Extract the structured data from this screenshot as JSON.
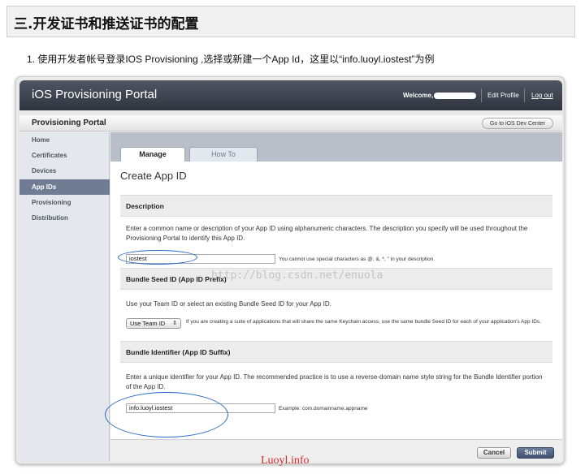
{
  "doc": {
    "heading": "三.开发证书和推送证书的配置",
    "step": "1. 使用开发者帐号登录IOS Provisioning ,选择或新建一个App Id，这里以“info.luoyl.iostest”为例"
  },
  "portal": {
    "title": "iOS Provisioning Portal",
    "welcome": "Welcome,",
    "edit_profile": "Edit Profile",
    "logout": "Log out",
    "subbar_title": "Provisioning Portal",
    "dev_center_button": "Go to iOS Dev Center"
  },
  "sidebar": {
    "items": [
      {
        "label": "Home"
      },
      {
        "label": "Certificates"
      },
      {
        "label": "Devices"
      },
      {
        "label": "App IDs"
      },
      {
        "label": "Provisioning"
      },
      {
        "label": "Distribution"
      }
    ],
    "active_index": 3
  },
  "tabs": [
    {
      "label": "Manage"
    },
    {
      "label": "How To"
    }
  ],
  "page_title": "Create App ID",
  "description": {
    "heading": "Description",
    "text": "Enter a common name or description of your App ID using alphanumeric characters. The description you specify will be used throughout the Provisioning Portal to identify this App ID.",
    "value": "iostest",
    "hint": "You cannot use special characters as @, &, *, \" in your description."
  },
  "bundle_seed": {
    "heading": "Bundle Seed ID (App ID Prefix)",
    "text": "Use your Team ID or select an existing Bundle Seed ID for your App ID.",
    "select_value": "Use Team ID",
    "hint": "If you are creating a suite of applications that will share the same Keychain access, use the same bundle Seed ID for each of your application's App IDs."
  },
  "bundle_identifier": {
    "heading": "Bundle Identifier (App ID Suffix)",
    "text": "Enter a unique identifier for your App ID. The recommended practice is to use a reverse-domain name style string for the Bundle Identifier portion of the App ID.",
    "value": "info.luoyl.iostest",
    "hint": "Example: com.domainname.appname"
  },
  "buttons": {
    "cancel": "Cancel",
    "submit": "Submit"
  },
  "watermark": "http://blog.csdn.net/enuola",
  "signature": "Luoyl.info",
  "colors": {
    "highlight_ellipse": "#2a68c9",
    "signature": "#d42b2b",
    "active_sidebar": "#6f7c93"
  }
}
